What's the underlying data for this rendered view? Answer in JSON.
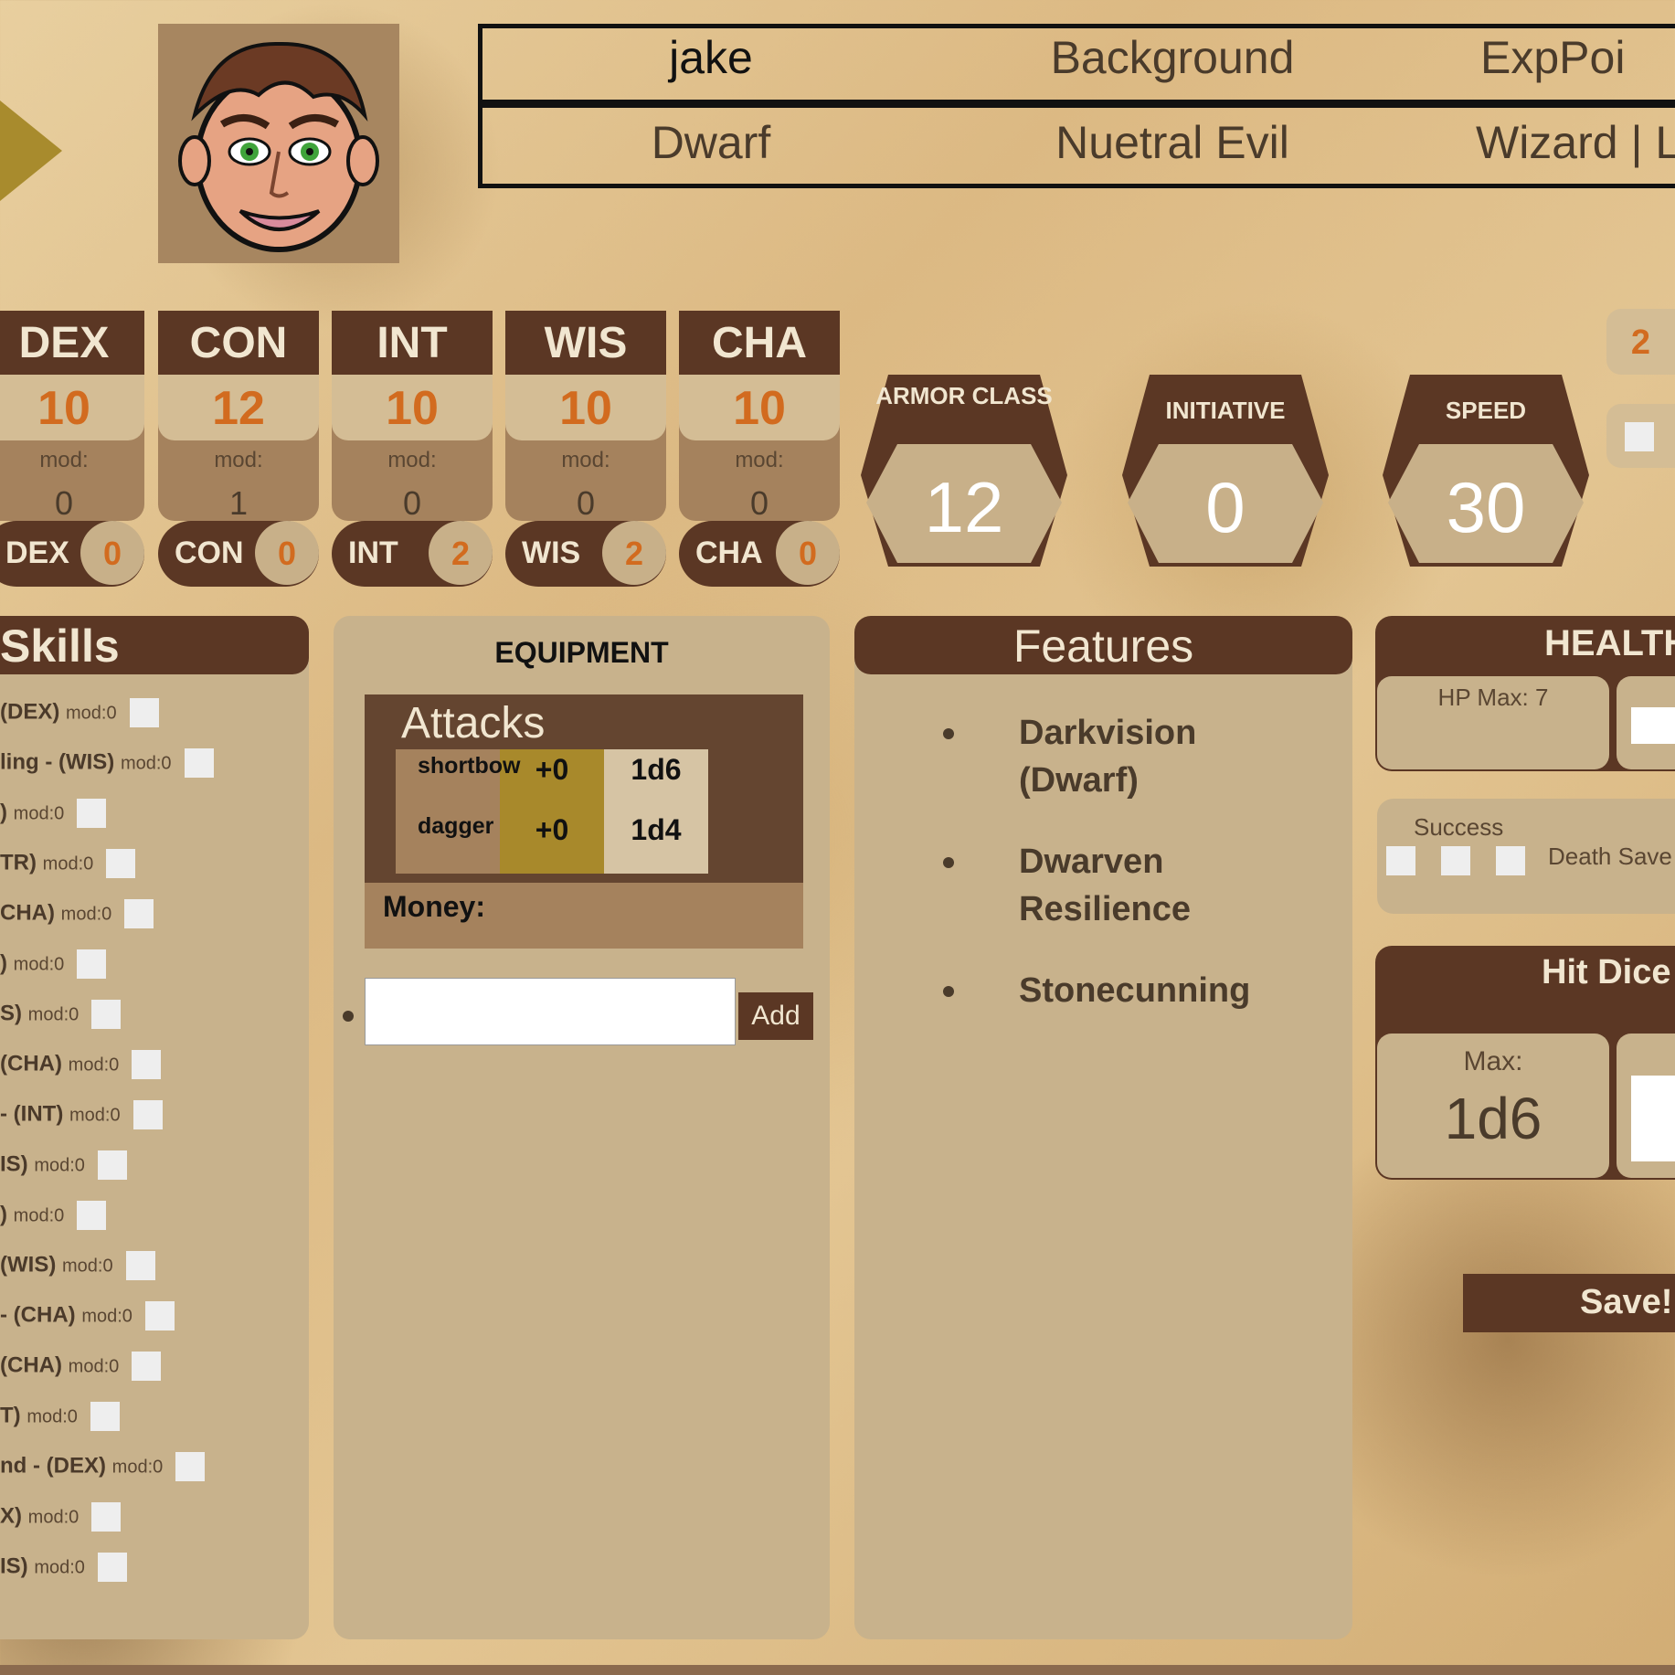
{
  "character": {
    "name": "jake",
    "background": "Background",
    "exp": "ExpPoi",
    "race": "Dwarf",
    "alignment": "Nuetral Evil",
    "class": "Wizard | L"
  },
  "stats": [
    {
      "abbr": "DEX",
      "score": "10",
      "mod_label": "mod:",
      "mod": "0",
      "save_label": "DEX",
      "save": "0"
    },
    {
      "abbr": "CON",
      "score": "12",
      "mod_label": "mod:",
      "mod": "1",
      "save_label": "CON",
      "save": "0"
    },
    {
      "abbr": "INT",
      "score": "10",
      "mod_label": "mod:",
      "mod": "0",
      "save_label": "INT",
      "save": "2"
    },
    {
      "abbr": "WIS",
      "score": "10",
      "mod_label": "mod:",
      "mod": "0",
      "save_label": "WIS",
      "save": "2"
    },
    {
      "abbr": "CHA",
      "score": "10",
      "mod_label": "mod:",
      "mod": "0",
      "save_label": "CHA",
      "save": "0"
    }
  ],
  "combat": {
    "armor_class_label": "ARMOR CLASS",
    "armor_class": "12",
    "initiative_label": "INITIATIVE",
    "initiative": "0",
    "speed_label": "SPEED",
    "speed": "30",
    "proficiency": "2"
  },
  "skills": {
    "title": "Skills",
    "items": [
      {
        "name": "(DEX)",
        "mod": "mod:0"
      },
      {
        "name": "ling - (WIS)",
        "mod": "mod:0"
      },
      {
        "name": ")",
        "mod": "mod:0"
      },
      {
        "name": "TR)",
        "mod": "mod:0"
      },
      {
        "name": "CHA)",
        "mod": "mod:0"
      },
      {
        "name": ")",
        "mod": "mod:0"
      },
      {
        "name": "S)",
        "mod": "mod:0"
      },
      {
        "name": "(CHA)",
        "mod": "mod:0"
      },
      {
        "name": "- (INT)",
        "mod": "mod:0"
      },
      {
        "name": "IS)",
        "mod": "mod:0"
      },
      {
        "name": ")",
        "mod": "mod:0"
      },
      {
        "name": "(WIS)",
        "mod": "mod:0"
      },
      {
        "name": "- (CHA)",
        "mod": "mod:0"
      },
      {
        "name": "(CHA)",
        "mod": "mod:0"
      },
      {
        "name": "T)",
        "mod": "mod:0"
      },
      {
        "name": "nd - (DEX)",
        "mod": "mod:0"
      },
      {
        "name": "X)",
        "mod": "mod:0"
      },
      {
        "name": "IS)",
        "mod": "mod:0"
      }
    ]
  },
  "equipment": {
    "title": "EQUIPMENT",
    "attacks_title": "Attacks",
    "attacks": [
      {
        "name": "shortbow",
        "bonus": "+0",
        "damage": "1d6"
      },
      {
        "name": "dagger",
        "bonus": "+0",
        "damage": "1d4"
      }
    ],
    "money_label": "Money:",
    "add_input_value": "",
    "add_label": "Add"
  },
  "features": {
    "title": "Features",
    "items": [
      {
        "line1": "Darkvision",
        "line2": "(Dwarf)"
      },
      {
        "line1": "Dwarven",
        "line2": "Resilience"
      },
      {
        "line1": "Stonecunning",
        "line2": ""
      }
    ]
  },
  "health": {
    "title": "HEALTH",
    "hp_max": "HP Max: 7",
    "success_label": "Success",
    "death_saves_label": "Death Save",
    "hit_dice_title": "Hit Dice",
    "hit_dice_max_label": "Max:",
    "hit_dice_max": "1d6"
  },
  "save_button": "Save!"
}
